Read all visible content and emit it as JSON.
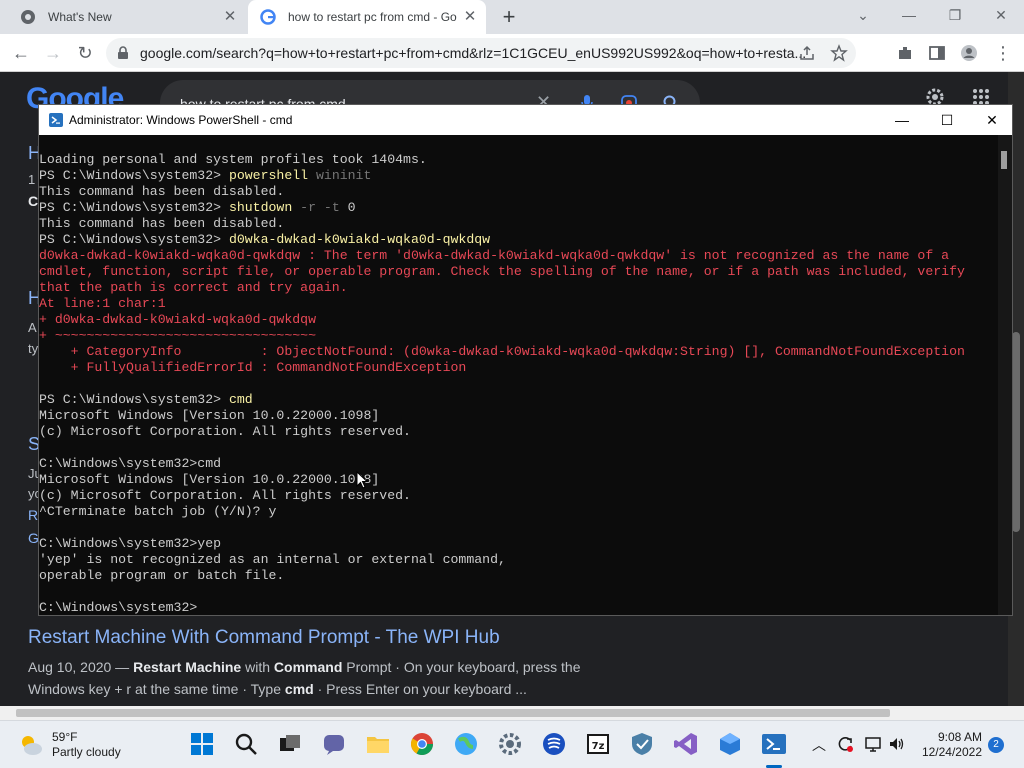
{
  "browser": {
    "tabs": [
      {
        "label": "What's New"
      },
      {
        "label": "how to restart pc from cmd - Go"
      }
    ],
    "new_tab": "+",
    "url": "google.com/search?q=how+to+restart+pc+from+cmd&rlz=1C1GCEU_enUS992US992&oq=how+to+resta..."
  },
  "google": {
    "logo": "Google",
    "query": "how to restart pc from cmd",
    "left_fragments": [
      "H",
      "1",
      "C",
      "H",
      "A",
      "ty",
      "S",
      "Ju",
      "yo",
      "R",
      "G"
    ],
    "result": {
      "title": "Restart Machine With Command Prompt - The WPI Hub",
      "date": "Aug 10, 2020 — ",
      "s1": "Restart Machine",
      "s2": " with ",
      "s3": "Command",
      "s4": " Prompt · On your keyboard, press the",
      "s5": "Windows key + r at the same time · Type ",
      "s6": "cmd",
      "s7": " · Press Enter on your keyboard ..."
    }
  },
  "powershell": {
    "title": "Administrator: Windows PowerShell - cmd",
    "lines": [
      {
        "type": "out",
        "text": "Loading personal and system profiles took 1404ms."
      },
      {
        "type": "prompt",
        "prompt": "PS C:\\Windows\\system32> ",
        "cmd": "powershell",
        "args": " wininit"
      },
      {
        "type": "out",
        "text": "This command has been disabled."
      },
      {
        "type": "prompt",
        "prompt": "PS C:\\Windows\\system32> ",
        "cmd": "shutdown",
        "args": " -r -t ",
        "tail": "0"
      },
      {
        "type": "out",
        "text": "This command has been disabled."
      },
      {
        "type": "prompt",
        "prompt": "PS C:\\Windows\\system32> ",
        "cmd": "d0wka-dwkad-k0wiakd-wqka0d-qwkdqw",
        "args": ""
      },
      {
        "type": "err",
        "text": "d0wka-dwkad-k0wiakd-wqka0d-qwkdqw : The term 'd0wka-dwkad-k0wiakd-wqka0d-qwkdqw' is not recognized as the name of a"
      },
      {
        "type": "err",
        "text": "cmdlet, function, script file, or operable program. Check the spelling of the name, or if a path was included, verify"
      },
      {
        "type": "err",
        "text": "that the path is correct and try again."
      },
      {
        "type": "err",
        "text": "At line:1 char:1"
      },
      {
        "type": "err",
        "text": "+ d0wka-dwkad-k0wiakd-wqka0d-qwkdqw"
      },
      {
        "type": "err",
        "text": "+ ~~~~~~~~~~~~~~~~~~~~~~~~~~~~~~~~~"
      },
      {
        "type": "err",
        "text": "    + CategoryInfo          : ObjectNotFound: (d0wka-dwkad-k0wiakd-wqka0d-qwkdqw:String) [], CommandNotFoundException"
      },
      {
        "type": "err",
        "text": "    + FullyQualifiedErrorId : CommandNotFoundException"
      },
      {
        "type": "out",
        "text": ""
      },
      {
        "type": "prompt",
        "prompt": "PS C:\\Windows\\system32> ",
        "cmd": "cmd",
        "args": ""
      },
      {
        "type": "out",
        "text": "Microsoft Windows [Version 10.0.22000.1098]"
      },
      {
        "type": "out",
        "text": "(c) Microsoft Corporation. All rights reserved."
      },
      {
        "type": "out",
        "text": ""
      },
      {
        "type": "out",
        "text": "C:\\Windows\\system32>cmd"
      },
      {
        "type": "out",
        "text": "Microsoft Windows [Version 10.0.22000.1098]"
      },
      {
        "type": "out",
        "text": "(c) Microsoft Corporation. All rights reserved."
      },
      {
        "type": "out",
        "text": "^CTerminate batch job (Y/N)? y"
      },
      {
        "type": "out",
        "text": ""
      },
      {
        "type": "out",
        "text": "C:\\Windows\\system32>yep"
      },
      {
        "type": "out",
        "text": "'yep' is not recognized as an internal or external command,"
      },
      {
        "type": "out",
        "text": "operable program or batch file."
      },
      {
        "type": "out",
        "text": ""
      },
      {
        "type": "out",
        "text": "C:\\Windows\\system32>"
      }
    ]
  },
  "taskbar": {
    "weather_temp": "59°F",
    "weather_desc": "Partly cloudy",
    "time": "9:08 AM",
    "date": "12/24/2022",
    "notification_count": "2",
    "apps": [
      "start-icon",
      "search-icon",
      "task-view-icon",
      "chat-icon",
      "file-explorer-icon",
      "chrome-icon",
      "globe-app-icon",
      "settings-icon",
      "vpn-icon",
      "7zip-icon",
      "shield-icon",
      "visual-studio-icon",
      "app-cube-icon",
      "powershell-icon"
    ]
  },
  "colors": {
    "ps_background": "#0c0c0c",
    "ps_text": "#cccccc",
    "ps_command": "#f9f1a5",
    "ps_error": "#e74856",
    "google_link": "#8ab4f8",
    "google_bg": "#202124"
  }
}
